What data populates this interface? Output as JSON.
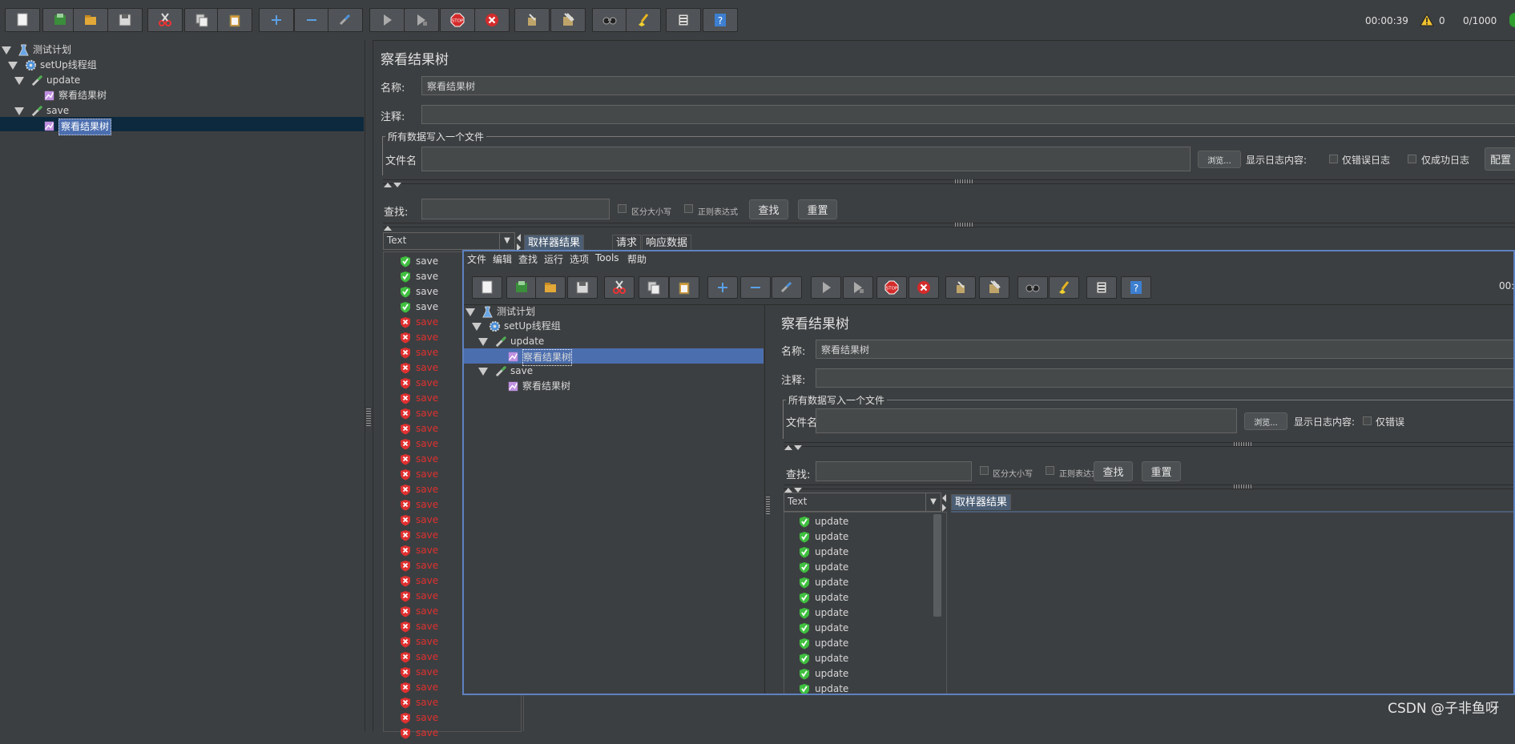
{
  "toolbar": {
    "buttons": [
      "new-icon",
      "templates-icon",
      "open-icon",
      "save-icon",
      "cut-icon",
      "copy-icon",
      "paste-icon",
      "expand-icon",
      "collapse-icon",
      "toggle-icon",
      "start-icon",
      "start-no-pause-icon",
      "stop-icon",
      "shutdown-icon",
      "clear-icon",
      "clear-all-icon",
      "search-icon",
      "reset-search-icon",
      "function-helper-icon",
      "help-icon"
    ],
    "elapsed": "00:00:39",
    "warnings": "0",
    "threads": "0/1000"
  },
  "tree": {
    "items": [
      {
        "label": "测试计划",
        "icon": "flask-icon"
      },
      {
        "label": "setUp线程组",
        "icon": "gear-icon"
      },
      {
        "label": "update",
        "icon": "pipette-icon"
      },
      {
        "label": "察看结果树",
        "icon": "chart-icon"
      },
      {
        "label": "save",
        "icon": "pipette-icon"
      },
      {
        "label": "察看结果树",
        "icon": "chart-icon"
      }
    ]
  },
  "panel": {
    "title": "察看结果树",
    "name_label": "名称:",
    "name_value": "察看结果树",
    "comment_label": "注释:",
    "comment_value": "",
    "file_group_title": "所有数据写入一个文件",
    "filename_label": "文件名",
    "browse_label": "浏览...",
    "log_label": "显示日志内容:",
    "errors_only": "仅错误日志",
    "success_only": "仅成功日志",
    "configure": "配置",
    "search_label": "查找:",
    "case_sensitive": "区分大小写",
    "regex": "正则表达式",
    "find_button": "查找",
    "reset_button": "重置",
    "renderer": "Text",
    "tabs": [
      "取样器结果",
      "请求",
      "响应数据"
    ]
  },
  "results": {
    "rows": [
      {
        "label": "save",
        "status": "success"
      },
      {
        "label": "save",
        "status": "success"
      },
      {
        "label": "save",
        "status": "success"
      },
      {
        "label": "save",
        "status": "success"
      },
      {
        "label": "save",
        "status": "error"
      },
      {
        "label": "save",
        "status": "error"
      },
      {
        "label": "save",
        "status": "error"
      },
      {
        "label": "save",
        "status": "error"
      },
      {
        "label": "save",
        "status": "error"
      },
      {
        "label": "save",
        "status": "error"
      },
      {
        "label": "save",
        "status": "error"
      },
      {
        "label": "save",
        "status": "error"
      },
      {
        "label": "save",
        "status": "error"
      },
      {
        "label": "save",
        "status": "error"
      },
      {
        "label": "save",
        "status": "error"
      },
      {
        "label": "save",
        "status": "error"
      },
      {
        "label": "save",
        "status": "error"
      },
      {
        "label": "save",
        "status": "error"
      },
      {
        "label": "save",
        "status": "error"
      },
      {
        "label": "save",
        "status": "error"
      },
      {
        "label": "save",
        "status": "error"
      },
      {
        "label": "save",
        "status": "error"
      },
      {
        "label": "save",
        "status": "error"
      },
      {
        "label": "save",
        "status": "error"
      },
      {
        "label": "save",
        "status": "error"
      },
      {
        "label": "save",
        "status": "error"
      },
      {
        "label": "save",
        "status": "error"
      },
      {
        "label": "save",
        "status": "error"
      },
      {
        "label": "save",
        "status": "error"
      },
      {
        "label": "save",
        "status": "error"
      },
      {
        "label": "save",
        "status": "error"
      },
      {
        "label": "save",
        "status": "error"
      }
    ]
  },
  "inner": {
    "menu": [
      "文件",
      "编辑",
      "查找",
      "运行",
      "选项",
      "Tools",
      "帮助"
    ],
    "elapsed_partial": "00:",
    "tree": [
      {
        "label": "测试计划"
      },
      {
        "label": "setUp线程组"
      },
      {
        "label": "update"
      },
      {
        "label": "察看结果树"
      },
      {
        "label": "save"
      },
      {
        "label": "察看结果树"
      }
    ],
    "title": "察看结果树",
    "name_label": "名称:",
    "name_value": "察看结果树",
    "comment_label": "注释:",
    "file_group_title": "所有数据写入一个文件",
    "filename_label": "文件名",
    "browse_label": "浏览...",
    "log_label": "显示日志内容:",
    "errors_partial": "仅错误",
    "search_label": "查找:",
    "case_sensitive": "区分大小写",
    "regex": "正则表达式",
    "find_button": "查找",
    "reset_button": "重置",
    "renderer": "Text",
    "tab": "取样器结果",
    "results": [
      "update",
      "update",
      "update",
      "update",
      "update",
      "update",
      "update",
      "update",
      "update",
      "update",
      "update",
      "update"
    ]
  },
  "watermark": "CSDN @子非鱼呀",
  "colors": {
    "success": "#3fbf3f",
    "error": "#e03030",
    "selection": "#4b6eaf",
    "tree_selection": "#0d293e"
  }
}
